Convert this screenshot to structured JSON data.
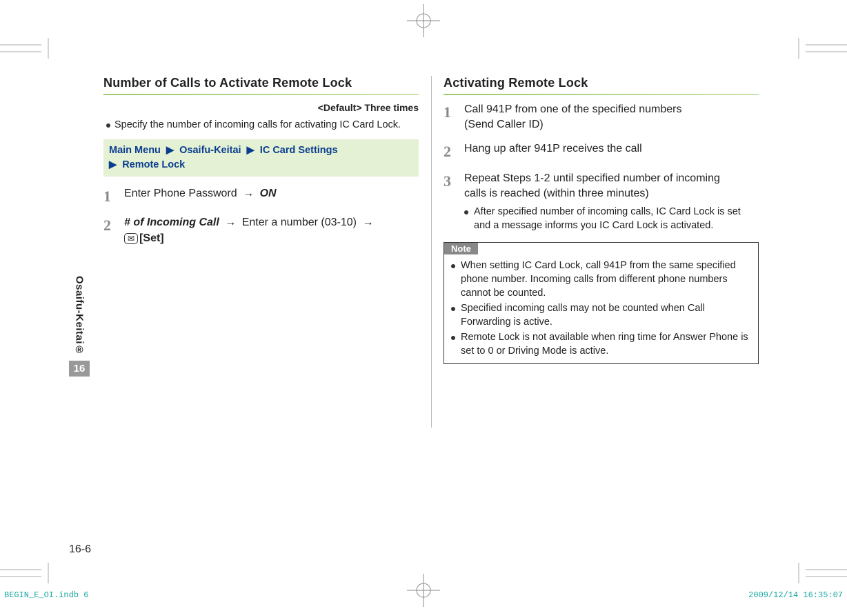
{
  "left": {
    "heading": "Number of Calls to Activate Remote Lock",
    "default_label": "<Default> Three times",
    "bullet": "Specify the number of incoming calls for activating IC Card Lock.",
    "nav": {
      "a": "Main Menu",
      "b": "Osaifu-Keitai",
      "c": "IC Card Settings",
      "d": "Remote Lock"
    },
    "step1_pre": "Enter Phone Password",
    "step1_on": "ON",
    "step2_bi": "# of Incoming Call",
    "step2_mid": "Enter a number (03-10)",
    "step2_set": "[Set]"
  },
  "right": {
    "heading": "Activating Remote Lock",
    "step1a": "Call 941P from one of the specified numbers",
    "step1b": "(Send Caller ID)",
    "step2": "Hang up after 941P receives the call",
    "step3a": "Repeat Steps 1-2 until specified number of incoming",
    "step3b": "calls is reached (within three minutes)",
    "sub": "After specified number of incoming calls, IC Card Lock is set and a message informs you IC Card Lock is activated.",
    "note_label": "Note",
    "note1": "When setting IC Card Lock, call 941P from the same specified phone number.  Incoming calls from different phone numbers cannot be counted.",
    "note2": "Specified incoming calls may not be counted when Call Forwarding is active.",
    "note3": "Remote Lock is not available when ring time for Answer Phone is set to 0 or Driving Mode is active."
  },
  "side": {
    "label": "Osaifu-Keitai®",
    "num": "16"
  },
  "pagenum": "16-6",
  "foot": {
    "left": "BEGIN_E_OI.indb   6",
    "right": "2009/12/14   16:35:07"
  }
}
